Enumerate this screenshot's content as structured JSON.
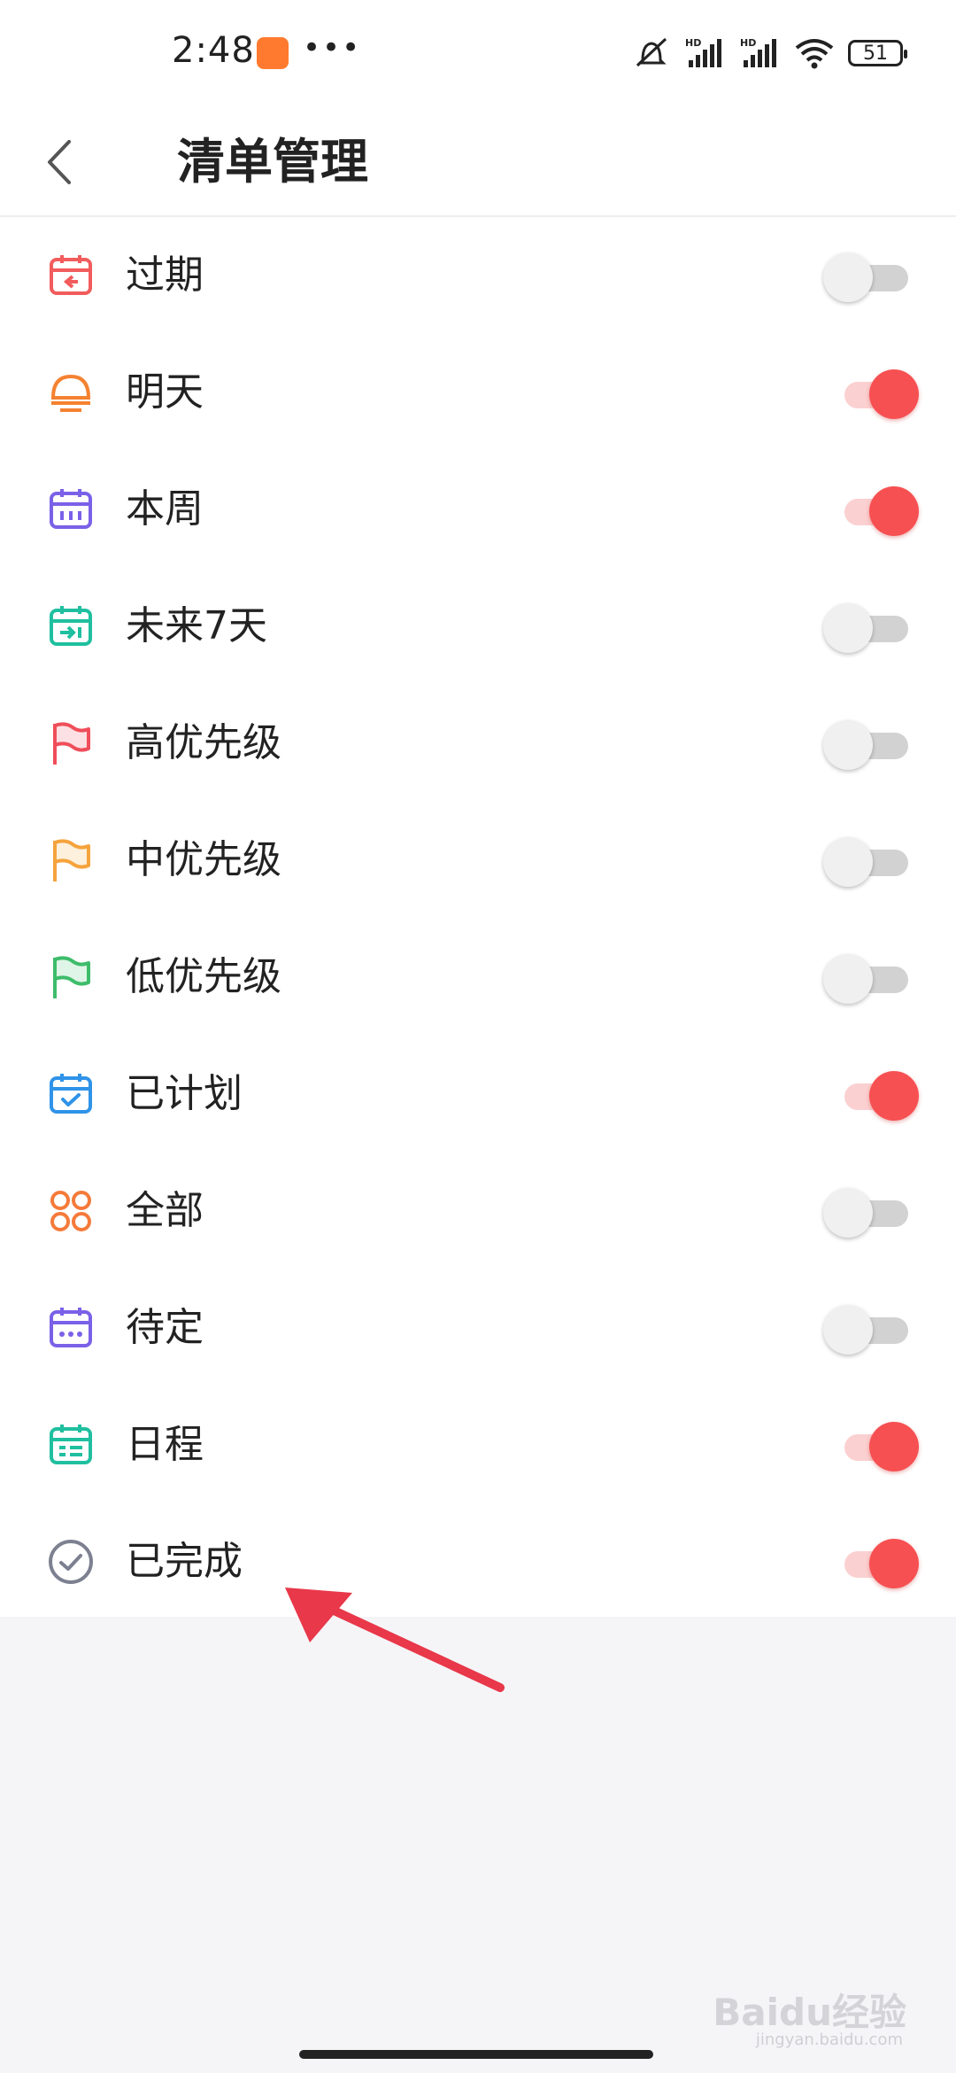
{
  "status_bar": {
    "time": "2:48",
    "dots": "•••",
    "battery": "51",
    "icons": [
      "notification-app-icon",
      "mute-icon",
      "hd-signal-icon",
      "hd-signal-icon",
      "wifi-icon",
      "battery-icon"
    ]
  },
  "header": {
    "title": "清单管理",
    "back_icon": "chevron-left-icon"
  },
  "colors": {
    "accent": "#f75052",
    "toggle_off_track": "#d2d2d2",
    "background": "#f5f5f7"
  },
  "list": {
    "items": [
      {
        "label": "过期",
        "icon": "calendar-expired-icon",
        "icon_color": "#f25c5c",
        "enabled": false
      },
      {
        "label": "明天",
        "icon": "sunrise-icon",
        "icon_color": "#f58231",
        "enabled": true
      },
      {
        "label": "本周",
        "icon": "calendar-week-icon",
        "icon_color": "#7b61e8",
        "enabled": true
      },
      {
        "label": "未来7天",
        "icon": "calendar-next-icon",
        "icon_color": "#1fbf9f",
        "enabled": false
      },
      {
        "label": "高优先级",
        "icon": "flag-high-icon",
        "icon_color": "#ef4e5a",
        "enabled": false
      },
      {
        "label": "中优先级",
        "icon": "flag-medium-icon",
        "icon_color": "#f5a33c",
        "enabled": false
      },
      {
        "label": "低优先级",
        "icon": "flag-low-icon",
        "icon_color": "#3dbd6b",
        "enabled": false
      },
      {
        "label": "已计划",
        "icon": "calendar-check-icon",
        "icon_color": "#2f93e8",
        "enabled": true
      },
      {
        "label": "全部",
        "icon": "grid-circles-icon",
        "icon_color": "#f57a3a",
        "enabled": false
      },
      {
        "label": "待定",
        "icon": "calendar-dots-icon",
        "icon_color": "#7b61e8",
        "enabled": false
      },
      {
        "label": "日程",
        "icon": "calendar-list-icon",
        "icon_color": "#1fbf9f",
        "enabled": true
      },
      {
        "label": "已完成",
        "icon": "check-circle-icon",
        "icon_color": "#7c8090",
        "enabled": true
      }
    ]
  },
  "watermark": {
    "text": "Baidu经验",
    "sub": "jingyan.baidu.com"
  }
}
